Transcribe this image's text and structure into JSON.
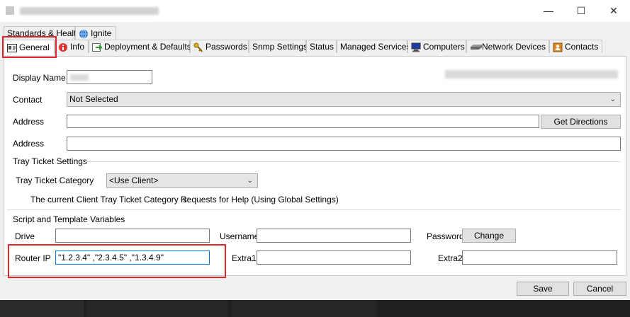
{
  "window": {
    "title": "",
    "controls": {
      "minimize": "—",
      "maximize": "☐",
      "close": "✕"
    }
  },
  "tabs_row1": [
    {
      "label": "Standards & Health",
      "icon": ""
    },
    {
      "label": "Ignite",
      "icon": "globe-icon"
    }
  ],
  "tabs_row2": [
    {
      "label": "General",
      "icon": "id-card-icon",
      "active": true
    },
    {
      "label": "Info",
      "icon": "info-icon"
    },
    {
      "label": "Deployment & Defaults",
      "icon": "deploy-arrow-icon"
    },
    {
      "label": "Passwords",
      "icon": "key-icon"
    },
    {
      "label": "Snmp Settings",
      "icon": ""
    },
    {
      "label": "Status",
      "icon": ""
    },
    {
      "label": "Managed Services",
      "icon": ""
    },
    {
      "label": "Computers",
      "icon": "computer-icon"
    },
    {
      "label": "Network Devices",
      "icon": "network-device-icon"
    },
    {
      "label": "Contacts",
      "icon": "contact-card-icon"
    }
  ],
  "general": {
    "display_name_label": "Display Name",
    "display_name_value": "",
    "contact_label": "Contact",
    "contact_value": "Not Selected",
    "address1_label": "Address",
    "address1_value": "",
    "get_directions": "Get Directions",
    "address2_label": "Address",
    "address2_value": ""
  },
  "tray": {
    "group_title": "Tray Ticket Settings",
    "category_label": "Tray Ticket Category",
    "category_value": "<Use Client>",
    "current_label": "The current Client Tray Ticket Category is:",
    "current_value": "Requests for Help (Using Global Settings)"
  },
  "script_vars": {
    "group_title": "Script and Template Variables",
    "drive_label": "Drive",
    "drive_value": "",
    "username_label": "Username",
    "username_value": "",
    "password_label": "Password",
    "change_button": "Change",
    "router_ip_label": "Router IP",
    "router_ip_value": "\"1.2.3.4\" ,\"2.3.4.5\" ,\"1.3.4.9\"",
    "extra1_label": "Extra1",
    "extra1_value": "",
    "extra2_label": "Extra2",
    "extra2_value": ""
  },
  "footer": {
    "save": "Save",
    "cancel": "Cancel"
  },
  "colors": {
    "highlight": "#e0262d",
    "panel_bg": "#ffffff",
    "window_bg": "#f0f0f0"
  }
}
